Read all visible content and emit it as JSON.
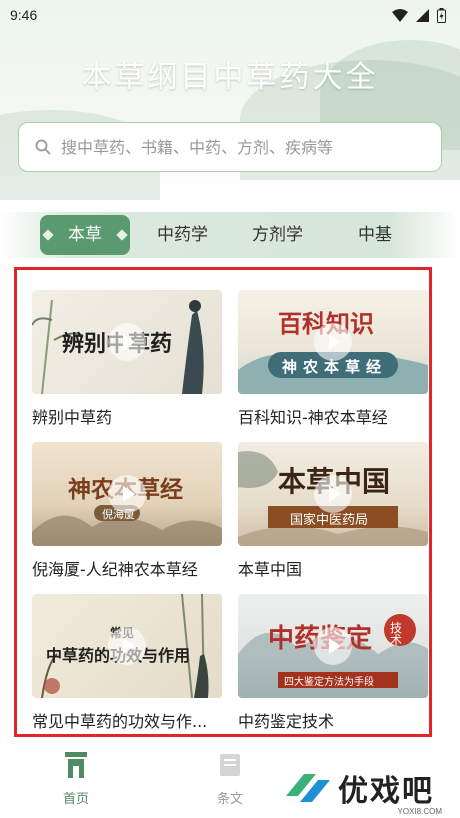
{
  "status_bar": {
    "time": "9:46"
  },
  "app_title": "本草纲目中草药大全",
  "search": {
    "placeholder": "搜中草药、书籍、中药、方剂、疾病等"
  },
  "tabs": [
    {
      "label": "本草",
      "active": true
    },
    {
      "label": "中药学",
      "active": false
    },
    {
      "label": "方剂学",
      "active": false
    },
    {
      "label": "中基",
      "active": false
    }
  ],
  "cards": [
    {
      "title": "辨别中草药",
      "thumb_text": "辨别中草药"
    },
    {
      "title": "百科知识-神农本草经",
      "thumb_text": "百科知识",
      "thumb_sub": "神农本草经"
    },
    {
      "title": "倪海厦-人纪神农本草经",
      "thumb_text": "神农本草经",
      "thumb_sub": "倪海厦"
    },
    {
      "title": "本草中国",
      "thumb_text": "本草中国",
      "thumb_sub": "国家中医药局"
    },
    {
      "title": "常见中草药的功效与作...",
      "thumb_text": "中草药的功效与作用",
      "thumb_sub": "常见"
    },
    {
      "title": "中药鉴定技术",
      "thumb_text": "中药鉴定",
      "thumb_sub": "四大鉴定方法为手段",
      "thumb_badge": "技术"
    }
  ],
  "bottom_nav": [
    {
      "label": "首页",
      "icon": "home-icon",
      "active": true
    },
    {
      "label": "条文",
      "icon": "book-icon",
      "active": false
    }
  ],
  "watermark": {
    "text": "优戏吧",
    "sub": "YOXI8.COM"
  },
  "colors": {
    "accent": "#5a9a6f",
    "highlight_frame": "#e0262a",
    "nav_active": "#4f8c63"
  }
}
